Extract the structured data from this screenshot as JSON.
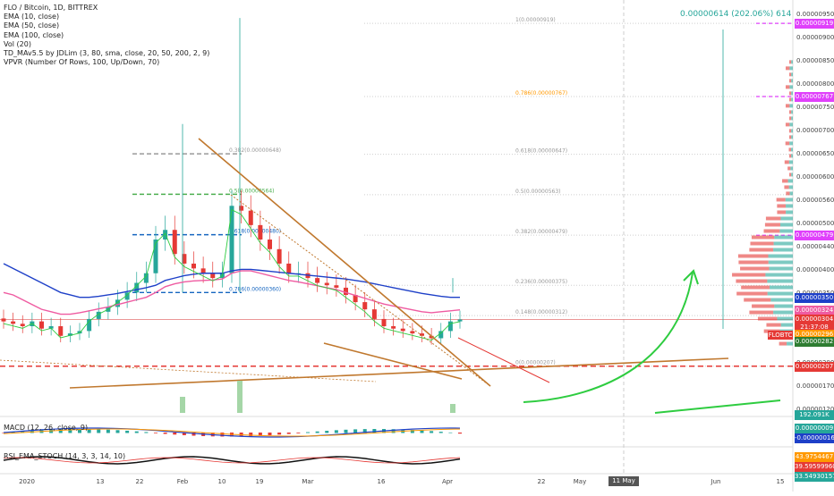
{
  "header": {
    "title": "FLO / Bitcoin, 1D, BITTREX",
    "indicators": [
      "EMA (10, close)",
      "EMA (50, close)",
      "EMA (100, close)",
      "Vol (20)",
      "TD_MAv5.5 by JDLim (3, 80, sma, close, 20, 50, 200, 2, 9)",
      "VPVR (Number Of Rows, 100, Up/Down, 70)"
    ]
  },
  "measure_label": "0.00000614 (202.06%) 614",
  "symbol_tag": "FLOBTC",
  "macd_label": "MACD (12, 26, close, 9)",
  "rsi_label": "RSI_EMA_STOCH (14, 3, 3, 14, 10)",
  "fib_right": [
    {
      "label": "1(0.00000919)",
      "value": 9.19e-06,
      "color": "#999999"
    },
    {
      "label": "0.786(0.00000767)",
      "value": 7.67e-06,
      "color": "#ff9800"
    },
    {
      "label": "0.618(0.00000647)",
      "value": 6.47e-06,
      "color": "#999999"
    },
    {
      "label": "0.5(0.00000563)",
      "value": 5.63e-06,
      "color": "#999999"
    },
    {
      "label": "0.382(0.00000479)",
      "value": 4.79e-06,
      "color": "#999999"
    },
    {
      "label": "0.236(0.00000375)",
      "value": 3.75e-06,
      "color": "#999999"
    },
    {
      "label": "0.148(0.00000312)",
      "value": 3.12e-06,
      "color": "#999999"
    },
    {
      "label": "0(0.00000207)",
      "value": 2.07e-06,
      "color": "#999999"
    }
  ],
  "fib_left": [
    {
      "label": "0.382(0.00000648)",
      "value": 6.48e-06,
      "color": "#999999"
    },
    {
      "label": "0.5(0.00000564)",
      "value": 5.64e-06,
      "color": "#4caf50"
    },
    {
      "label": "0.618(0.00000480)",
      "value": 4.8e-06,
      "color": "#1565c0"
    },
    {
      "label": "0.786(0.00000360)",
      "value": 3.6e-06,
      "color": "#1565c0"
    }
  ],
  "price_labels": [
    {
      "text": "0.00000919",
      "value": 9.19e-06,
      "color": "#e040fb"
    },
    {
      "text": "0.00000767",
      "value": 7.67e-06,
      "color": "#e040fb"
    },
    {
      "text": "0.00000479",
      "value": 4.79e-06,
      "color": "#e040fb"
    },
    {
      "text": "0.00000350",
      "value": 3.5e-06,
      "color": "#1e40c8"
    },
    {
      "text": "0.00000324",
      "value": 3.24e-06,
      "color": "#ef5ba1"
    },
    {
      "text": "0.00000304",
      "value": 3.04e-06,
      "color": "#e53935"
    },
    {
      "text": "21:37:08",
      "value": 2.89e-06,
      "color": "#e53935"
    },
    {
      "text": "0.00000296",
      "value": 2.74e-06,
      "color": "#ff9800"
    },
    {
      "text": "0.00000282",
      "value": 2.59e-06,
      "color": "#2e7d32"
    },
    {
      "text": "0.00000207",
      "value": 2.07e-06,
      "color": "#e53935"
    },
    {
      "text": "192.091K",
      "value": 1.07e-06,
      "color": "#26a69a"
    }
  ],
  "macd_labels": [
    {
      "text": "0.00000009",
      "color": "#26a69a"
    },
    {
      "text": "-0.00000016",
      "color": "#1e40c8"
    }
  ],
  "rsi_labels": [
    {
      "text": "43.9754467",
      "color": "#ff9800"
    },
    {
      "text": "39.59599960",
      "color": "#e53935"
    },
    {
      "text": "33.54930157",
      "color": "#26a69a"
    }
  ],
  "chart_data": {
    "type": "line",
    "title": "FLO / Bitcoin, 1D, BITTREX",
    "y_axis_ticks": [
      "0.00000950",
      "0.00000900",
      "0.00000850",
      "0.00000800",
      "0.00000750",
      "0.00000700",
      "0.00000650",
      "0.00000600",
      "0.00000560",
      "0.00000500",
      "0.00000440",
      "0.00000400",
      "0.00000350",
      "0.00000300",
      "0.00000250",
      "0.00000200",
      "0.00000170",
      "0.00000120"
    ],
    "ylim": [
      1.1e-06,
      9.6e-06
    ],
    "x_axis_ticks": [
      "2020",
      "13",
      "22",
      "Feb",
      "10",
      "19",
      "Mar",
      "16",
      "Apr",
      "22",
      "May",
      "11 May '20",
      "Jun",
      "15"
    ],
    "date_pill": "11 May '20",
    "series": [
      {
        "name": "FLO/BTC close",
        "color": "#26a69a",
        "values": [
          3e-06,
          2.95e-06,
          2.9e-06,
          3e-06,
          2.85e-06,
          2.9e-06,
          2.7e-06,
          2.75e-06,
          2.8e-06,
          3.05e-06,
          3.2e-06,
          3.3e-06,
          3.45e-06,
          3.6e-06,
          3.8e-06,
          4e-06,
          4.7e-06,
          4.9e-06,
          4.4e-06,
          4.2e-06,
          4.1e-06,
          4e-06,
          3.9e-06,
          4e-06,
          5.4e-06,
          5.3e-06,
          5e-06,
          4.7e-06,
          4.5e-06,
          4.2e-06,
          4e-06,
          4e-06,
          3.9e-06,
          3.8e-06,
          3.75e-06,
          3.7e-06,
          3.55e-06,
          3.4e-06,
          3.25e-06,
          3.05e-06,
          2.9e-06,
          2.85e-06,
          2.8e-06,
          2.75e-06,
          2.7e-06,
          2.65e-06,
          2.8e-06,
          3e-06,
          3.04e-06
        ]
      },
      {
        "name": "EMA 100",
        "color": "#1e40c8",
        "values": [
          4.2e-06,
          4.1e-06,
          4e-06,
          3.9e-06,
          3.8e-06,
          3.7e-06,
          3.6e-06,
          3.55e-06,
          3.5e-06,
          3.5e-06,
          3.52e-06,
          3.55e-06,
          3.58e-06,
          3.62e-06,
          3.66e-06,
          3.7e-06,
          3.75e-06,
          3.85e-06,
          3.9e-06,
          3.95e-06,
          3.98e-06,
          4e-06,
          4e-06,
          4e-06,
          4.05e-06,
          4.08e-06,
          4.08e-06,
          4.06e-06,
          4.04e-06,
          4.02e-06,
          4e-06,
          3.98e-06,
          3.96e-06,
          3.94e-06,
          3.92e-06,
          3.9e-06,
          3.88e-06,
          3.85e-06,
          3.82e-06,
          3.78e-06,
          3.74e-06,
          3.7e-06,
          3.66e-06,
          3.62e-06,
          3.58e-06,
          3.55e-06,
          3.52e-06,
          3.5e-06,
          3.5e-06
        ]
      },
      {
        "name": "EMA 50",
        "color": "#ef5ba1",
        "values": [
          3.6e-06,
          3.55e-06,
          3.45e-06,
          3.35e-06,
          3.25e-06,
          3.2e-06,
          3.15e-06,
          3.15e-06,
          3.18e-06,
          3.22e-06,
          3.26e-06,
          3.3e-06,
          3.35e-06,
          3.4e-06,
          3.45e-06,
          3.5e-06,
          3.6e-06,
          3.72e-06,
          3.78e-06,
          3.82e-06,
          3.84e-06,
          3.85e-06,
          3.86e-06,
          3.88e-06,
          4e-06,
          4.05e-06,
          4.05e-06,
          4e-06,
          3.95e-06,
          3.9e-06,
          3.85e-06,
          3.82e-06,
          3.78e-06,
          3.74e-06,
          3.7e-06,
          3.66e-06,
          3.6e-06,
          3.54e-06,
          3.48e-06,
          3.42e-06,
          3.36e-06,
          3.32e-06,
          3.28e-06,
          3.24e-06,
          3.2e-06,
          3.18e-06,
          3.2e-06,
          3.22e-06,
          3.24e-06
        ]
      }
    ],
    "grid": false,
    "legend": "top-left"
  },
  "colors": {
    "up": "#26a69a",
    "down": "#e53935",
    "fib_magenta": "#e040fb",
    "trend_brown": "#c0782e",
    "arrow_green": "#2ecc40"
  }
}
